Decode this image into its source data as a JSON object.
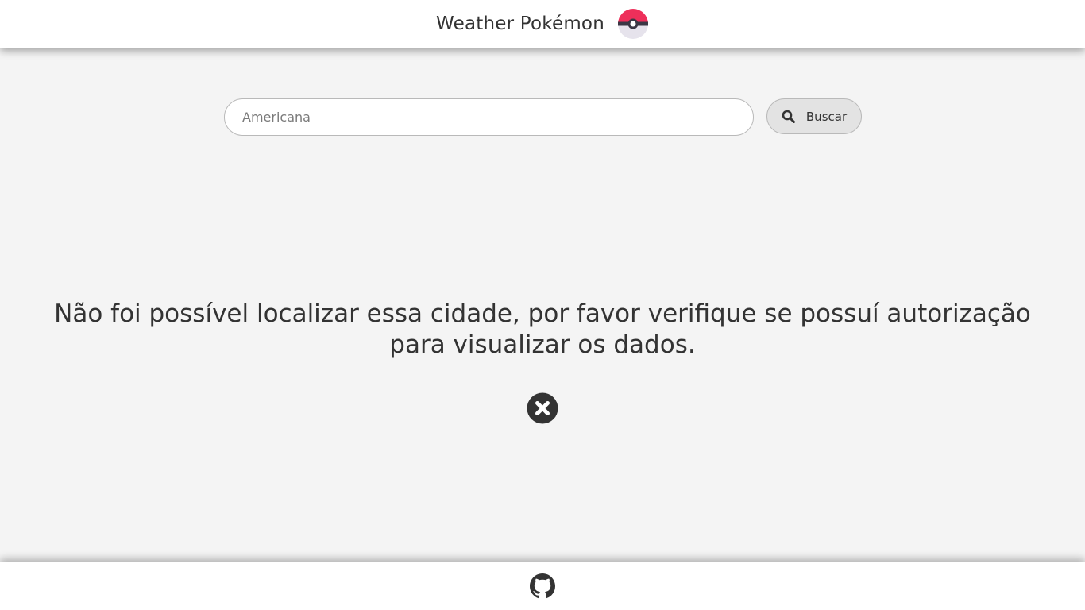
{
  "header": {
    "title": "Weather Pokémon",
    "logo_icon": "pokeball-icon"
  },
  "search": {
    "placeholder": "Americana",
    "value": "",
    "button_label": "Buscar",
    "button_icon": "search-icon"
  },
  "main": {
    "error_message": "Não foi possível localizar essa cidade, por favor verifique se possuí autorização para visualizar os dados.",
    "error_icon": "close-circle-icon"
  },
  "footer": {
    "link_icon": "github-icon"
  },
  "colors": {
    "background": "#f4f4f4",
    "surface": "#ffffff",
    "text": "#333333",
    "pokeball_red": "#ee2f5a",
    "button_bg": "#e3e3e3"
  }
}
